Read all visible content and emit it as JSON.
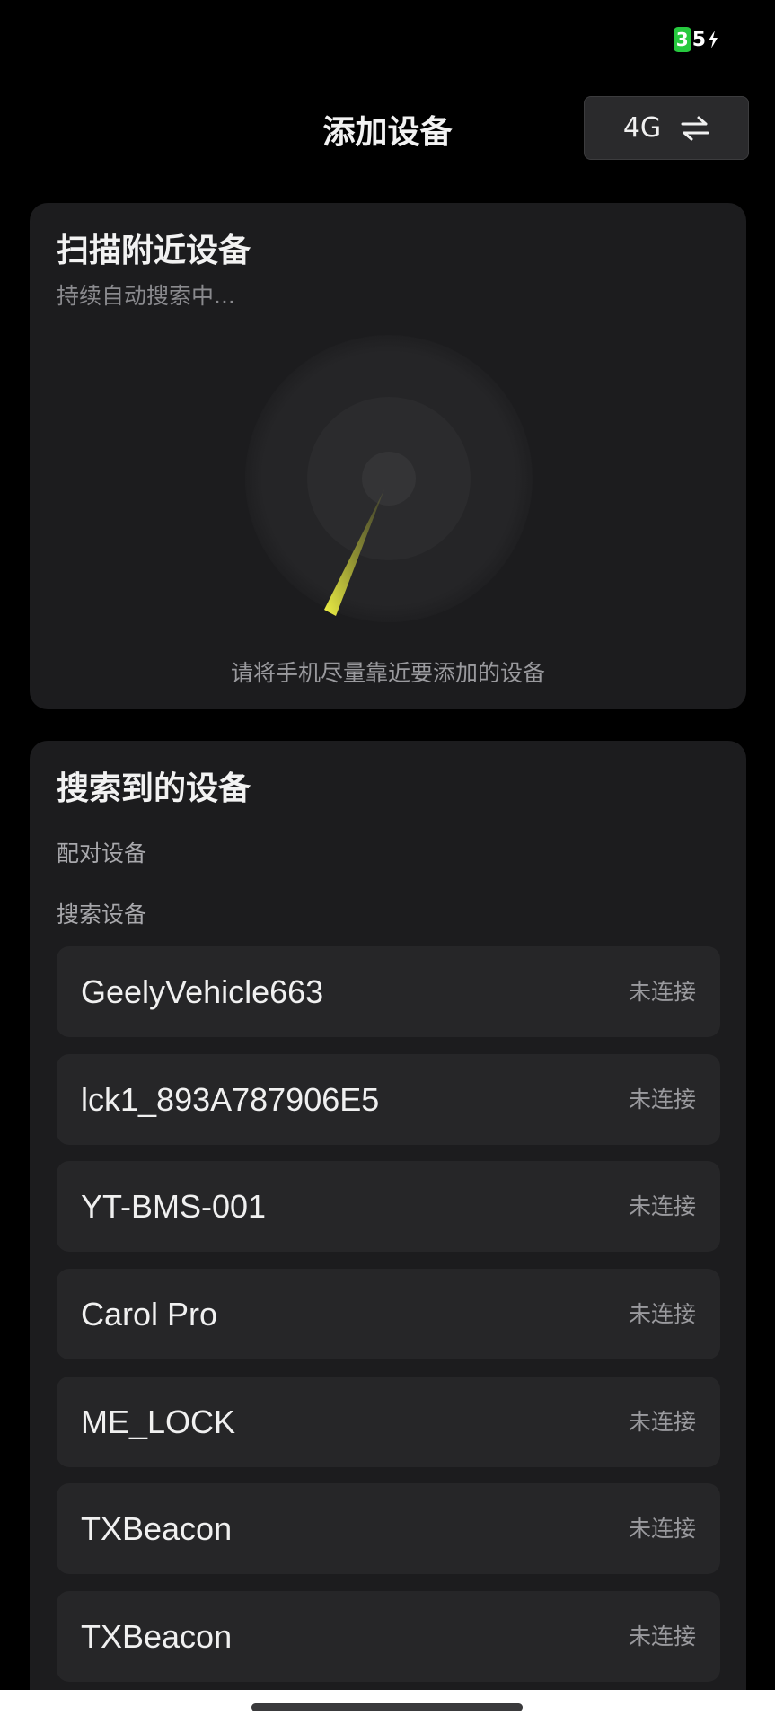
{
  "status_bar": {
    "battery_digit_highlight": "3",
    "battery_digit_rest": "5",
    "battery_color": "#27c93f",
    "charging_icon": "bolt-icon"
  },
  "header": {
    "title": "添加设备",
    "network_button_label": "4G",
    "network_button_icon": "swap-arrows-icon"
  },
  "scan": {
    "title": "扫描附近设备",
    "subtitle": "持续自动搜索中...",
    "hint": "请将手机尽量靠近要添加的设备",
    "accent_color": "#e0e33a"
  },
  "found": {
    "title": "搜索到的设备",
    "paired_label": "配对设备",
    "search_label": "搜索设备",
    "devices": [
      {
        "name": "GeelyVehicle663",
        "status": "未连接"
      },
      {
        "name": "lck1_893A787906E5",
        "status": "未连接"
      },
      {
        "name": "YT-BMS-001",
        "status": "未连接"
      },
      {
        "name": "Carol Pro",
        "status": "未连接"
      },
      {
        "name": "ME_LOCK",
        "status": "未连接"
      },
      {
        "name": "TXBeacon",
        "status": "未连接"
      },
      {
        "name": "TXBeacon",
        "status": "未连接"
      }
    ]
  }
}
